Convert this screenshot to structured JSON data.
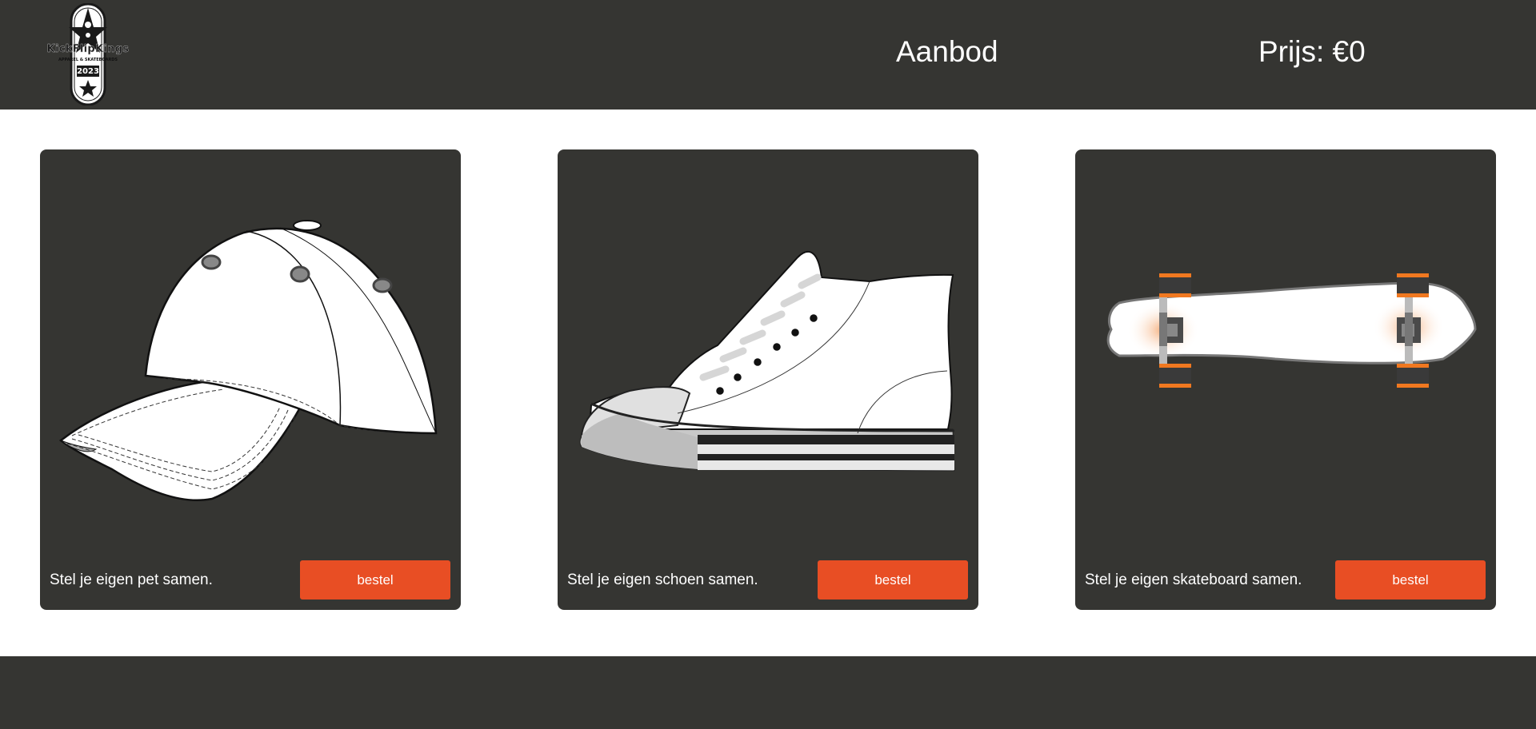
{
  "header": {
    "logo": {
      "brand": "KickFlipKings",
      "tagline": "APPAREL & SKATEBOARDS",
      "year": "2023"
    },
    "nav_offer": "Aanbod",
    "price": "Prijs: €0"
  },
  "products": [
    {
      "caption": "Stel je eigen pet samen.",
      "button": "bestel",
      "icon": "cap"
    },
    {
      "caption": "Stel je eigen schoen samen.",
      "button": "bestel",
      "icon": "sneaker"
    },
    {
      "caption": "Stel je eigen skateboard samen.",
      "button": "bestel",
      "icon": "skateboard"
    }
  ],
  "colors": {
    "dark": "#353532",
    "accent": "#e84e24",
    "text_light": "#ffffff",
    "wheel": "#f07820"
  }
}
